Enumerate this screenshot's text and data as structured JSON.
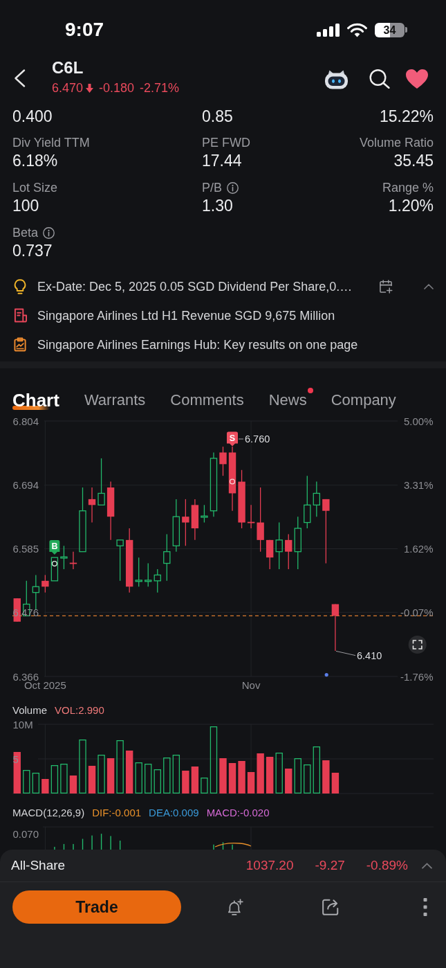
{
  "status_bar": {
    "time": "9:07",
    "battery": "34"
  },
  "header": {
    "symbol": "C6L",
    "price": "6.470",
    "falling": true,
    "change": "-0.180",
    "change_percent": "-2.71%",
    "favorite": true
  },
  "stats": [
    {
      "cells": [
        {
          "value": "0.400",
          "info": false
        },
        {
          "value": "0.85",
          "info": false
        },
        {
          "value": "15.22%",
          "info": false
        }
      ]
    },
    {
      "cells": [
        {
          "label": "Div Yield TTM",
          "value": "6.18%",
          "info": false
        },
        {
          "label": "PE FWD",
          "value": "17.44",
          "info": false
        },
        {
          "label": "Volume Ratio",
          "value": "35.45",
          "info": false
        }
      ]
    },
    {
      "cells": [
        {
          "label": "Lot Size",
          "value": "100",
          "info": false
        },
        {
          "label": "P/B",
          "value": "1.30",
          "info": true
        },
        {
          "label": "Range %",
          "value": "1.20%",
          "info": false
        }
      ]
    },
    {
      "cells": [
        {
          "label": "Beta",
          "value": "0.737",
          "info": true
        }
      ]
    }
  ],
  "notices": {
    "expanded": true,
    "items": [
      {
        "kind": "dividend",
        "text": "Ex-Date: Dec 5, 2025 0.05 SGD Dividend Per Share,0.…"
      },
      {
        "kind": "report",
        "text": "Singapore Airlines Ltd H1 Revenue SGD 9,675 Million"
      },
      {
        "kind": "earnings",
        "text": "Singapore Airlines Earnings Hub: Key results on one page"
      }
    ]
  },
  "tabs": [
    {
      "label": "Chart",
      "selected": true,
      "dot": false
    },
    {
      "label": "Warrants",
      "selected": false,
      "dot": false
    },
    {
      "label": "Comments",
      "selected": false,
      "dot": false
    },
    {
      "label": "News",
      "selected": false,
      "dot": true
    },
    {
      "label": "Company",
      "selected": false,
      "dot": false
    }
  ],
  "price_chart": {
    "chart_data": {
      "type": "candlestick",
      "grid": true,
      "categories": [
        null,
        null,
        null,
        "Oct 2025",
        null,
        null,
        null,
        null,
        null,
        null,
        null,
        null,
        null,
        null,
        null,
        null,
        null,
        null,
        null,
        null,
        null,
        null,
        null,
        null,
        null,
        "Nov",
        null,
        null,
        null,
        null,
        null,
        null,
        null,
        null,
        null,
        null,
        null,
        null,
        null,
        null,
        null,
        null,
        null,
        null,
        null
      ],
      "ohlc": [
        [
          6.5,
          6.5,
          6.46,
          6.46
        ],
        [
          6.47,
          6.53,
          6.47,
          6.49
        ],
        [
          6.51,
          6.54,
          6.48,
          6.52
        ],
        [
          6.53,
          6.54,
          6.51,
          6.52
        ],
        [
          6.53,
          6.57,
          6.53,
          6.57
        ],
        [
          6.569,
          6.59,
          6.55,
          6.571
        ],
        [
          6.561,
          6.58,
          6.55,
          6.559
        ],
        [
          6.58,
          6.69,
          6.58,
          6.65
        ],
        [
          6.67,
          6.69,
          6.63,
          6.66
        ],
        [
          6.66,
          6.74,
          6.66,
          6.68
        ],
        [
          6.69,
          6.7,
          6.6,
          6.64
        ],
        [
          6.59,
          6.6,
          6.53,
          6.6
        ],
        [
          6.6,
          6.62,
          6.51,
          6.52
        ],
        [
          6.529,
          6.57,
          6.52,
          6.531
        ],
        [
          6.529,
          6.56,
          6.52,
          6.531
        ],
        [
          6.53,
          6.55,
          6.51,
          6.54
        ],
        [
          6.56,
          6.61,
          6.53,
          6.58
        ],
        [
          6.59,
          6.67,
          6.58,
          6.64
        ],
        [
          6.64,
          6.67,
          6.59,
          6.63
        ],
        [
          6.66,
          6.67,
          6.6,
          6.62
        ],
        [
          6.639,
          6.66,
          6.63,
          6.641
        ],
        [
          6.65,
          6.75,
          6.64,
          6.74
        ],
        [
          6.75,
          6.76,
          6.71,
          6.73
        ],
        [
          6.75,
          6.76,
          6.65,
          6.68
        ],
        [
          6.7,
          6.72,
          6.62,
          6.63
        ],
        [
          6.631,
          6.66,
          6.62,
          6.629
        ],
        [
          6.63,
          6.69,
          6.58,
          6.6
        ],
        [
          6.6,
          6.6,
          6.55,
          6.57
        ],
        [
          6.58,
          6.63,
          6.55,
          6.6
        ],
        [
          6.6,
          6.61,
          6.55,
          6.58
        ],
        [
          6.58,
          6.64,
          6.55,
          6.62
        ],
        [
          6.63,
          6.71,
          6.62,
          6.66
        ],
        [
          6.66,
          6.7,
          6.64,
          6.68
        ],
        [
          6.67,
          6.67,
          6.56,
          6.65
        ],
        [
          6.49,
          6.49,
          6.41,
          6.47
        ],
        null,
        null,
        null,
        null,
        null,
        null,
        null,
        null,
        null,
        null
      ],
      "ylim": [
        6.366,
        6.804
      ],
      "yticks": [
        {
          "value": 6.804,
          "label": "6.804"
        },
        {
          "value": 6.694,
          "label": "6.694"
        },
        {
          "value": 6.585,
          "label": "6.585"
        },
        {
          "value": 6.476,
          "label": "6.476"
        },
        {
          "value": 6.366,
          "label": "6.366"
        }
      ],
      "ref_lines": [
        {
          "axis": "y",
          "value": 6.47
        }
      ]
    },
    "percent_ticks": [
      "5.00%",
      "3.31%",
      "1.62%",
      "-0.07%",
      "-1.76%"
    ],
    "high_label": "6.760",
    "low_label": "6.410",
    "markers": [
      {
        "kind": "buy",
        "label": "B"
      },
      {
        "kind": "sell",
        "label": "S"
      }
    ]
  },
  "volume": {
    "title": "Volume",
    "indicator": "VOL:2.990",
    "chart_data": {
      "type": "bar",
      "stacked": true,
      "grid": true,
      "categories": [
        null,
        null,
        null,
        null,
        null,
        null,
        null,
        null,
        null,
        null,
        null,
        null,
        null,
        null,
        null,
        null,
        null,
        null,
        null,
        null,
        null,
        null,
        null,
        null,
        null,
        null,
        null,
        null,
        null,
        null,
        null,
        null,
        null,
        null,
        null,
        null,
        null,
        null,
        null,
        null,
        null,
        null,
        null,
        null,
        null
      ],
      "ylim": [
        0,
        10
      ],
      "yticks": [
        {
          "value": 10,
          "label": "10M"
        },
        {
          "value": 5,
          "label": "5"
        }
      ],
      "series": [
        {
          "color": "#22b86b",
          "values": [
            null,
            3.4,
            3.0,
            null,
            4.1,
            4.3,
            null,
            7.8,
            null,
            5.6,
            null,
            7.7,
            null,
            4.5,
            4.3,
            3.5,
            5.2,
            5.6,
            null,
            null,
            2.3,
            9.7,
            null,
            null,
            null,
            null,
            null,
            null,
            5.9,
            null,
            5.1,
            4.2,
            6.8,
            null,
            null,
            null,
            null,
            null,
            null,
            null,
            null,
            null,
            null,
            null,
            null
          ]
        },
        {
          "color": "#e63d52",
          "values": [
            6.0,
            null,
            null,
            2.1,
            null,
            null,
            2.6,
            null,
            4.0,
            null,
            5.1,
            null,
            6.2,
            null,
            null,
            null,
            null,
            null,
            3.3,
            3.9,
            null,
            null,
            5.1,
            4.4,
            4.7,
            3.1,
            5.8,
            5.3,
            null,
            3.6,
            null,
            null,
            null,
            4.8,
            3.0,
            null,
            null,
            null,
            null,
            null,
            null,
            null,
            null,
            null,
            null
          ]
        }
      ]
    }
  },
  "macd": {
    "title": "MACD(12,26,9)",
    "dif": "DIF:-0.001",
    "dea": "DEA:0.009",
    "macd": "MACD:-0.020",
    "y_tick": "0.070"
  },
  "index_bar": {
    "name": "All-Share",
    "value": "1037.20",
    "change": "-9.27",
    "change_percent": "-0.89%",
    "falling": true,
    "expanded": false
  },
  "actions": {
    "trade": "Trade"
  }
}
